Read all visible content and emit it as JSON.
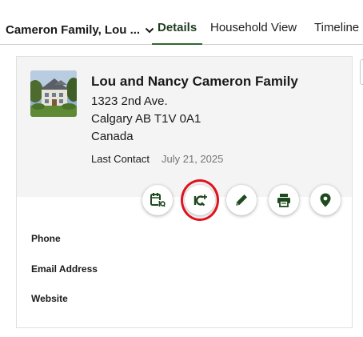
{
  "header": {
    "household_selector": "Cameron Family, Lou ...",
    "tabs": [
      {
        "label": "Details",
        "active": true
      },
      {
        "label": "Household View",
        "active": false
      },
      {
        "label": "Timeline",
        "active": false
      }
    ]
  },
  "card": {
    "family_name": "Lou and Nancy Cameron Family",
    "address": {
      "line1": "1323 2nd Ave.",
      "line2": "Calgary AB T1V 0A1",
      "country": "Canada"
    },
    "last_contact": {
      "label": "Last Contact",
      "value": "July 21, 2025"
    },
    "actions": [
      {
        "icon": "calendar-iq-icon"
      },
      {
        "icon": "iq-add-icon",
        "highlighted": true
      },
      {
        "icon": "pencil-icon"
      },
      {
        "icon": "print-icon"
      },
      {
        "icon": "map-pin-icon"
      }
    ],
    "fields": {
      "phone_label": "Phone",
      "email_label": "Email Address",
      "website_label": "Website"
    }
  },
  "colors": {
    "accent": "#2e6a2e",
    "icon": "#1f4a1f",
    "highlight": "#e0141e",
    "header_bg": "#f4f4f4"
  }
}
